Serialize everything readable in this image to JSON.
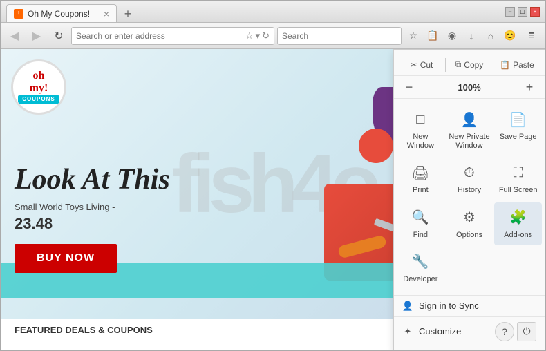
{
  "browser": {
    "tab_title": "Oh My Coupons!",
    "new_tab_label": "+",
    "address_placeholder": "Search or enter address",
    "search_placeholder": "Search",
    "window_controls": {
      "minimize": "−",
      "maximize": "□",
      "close": "×"
    }
  },
  "nav_icons": {
    "back": "◀",
    "forward": "▶",
    "refresh": "↻",
    "bookmark": "☆",
    "reading": "📋",
    "pocket": "◉",
    "download": "↓",
    "home": "⌂",
    "avatar": "😊",
    "menu": "≡"
  },
  "website": {
    "hero_title": "Look At This",
    "hero_subtitle": "Small World Toys Living -",
    "hero_price": "23.48",
    "buy_button": "BUY NOW",
    "featured_label": "FEATURED DEALS & COUPONS",
    "logo_top": "oh",
    "logo_cursive": "my!",
    "logo_banner": "COUPONS"
  },
  "dropdown": {
    "cut_label": "Cut",
    "copy_label": "Copy",
    "paste_label": "Paste",
    "zoom_value": "100%",
    "zoom_minus": "−",
    "zoom_plus": "+",
    "grid_items": [
      {
        "icon": "□",
        "label": "New Window"
      },
      {
        "icon": "👤",
        "label": "New Private Window"
      },
      {
        "icon": "📄",
        "label": "Save Page"
      },
      {
        "icon": "🖨",
        "label": "Print"
      },
      {
        "icon": "⏱",
        "label": "History"
      },
      {
        "icon": "⛶",
        "label": "Full Screen"
      },
      {
        "icon": "🔍",
        "label": "Find"
      },
      {
        "icon": "⚙",
        "label": "Options"
      },
      {
        "icon": "🧩",
        "label": "Add-ons"
      },
      {
        "icon": "🔧",
        "label": "Developer"
      }
    ],
    "sign_in_label": "Sign in to Sync",
    "customize_label": "Customize",
    "help_icon": "?",
    "power_icon": "⏻"
  }
}
